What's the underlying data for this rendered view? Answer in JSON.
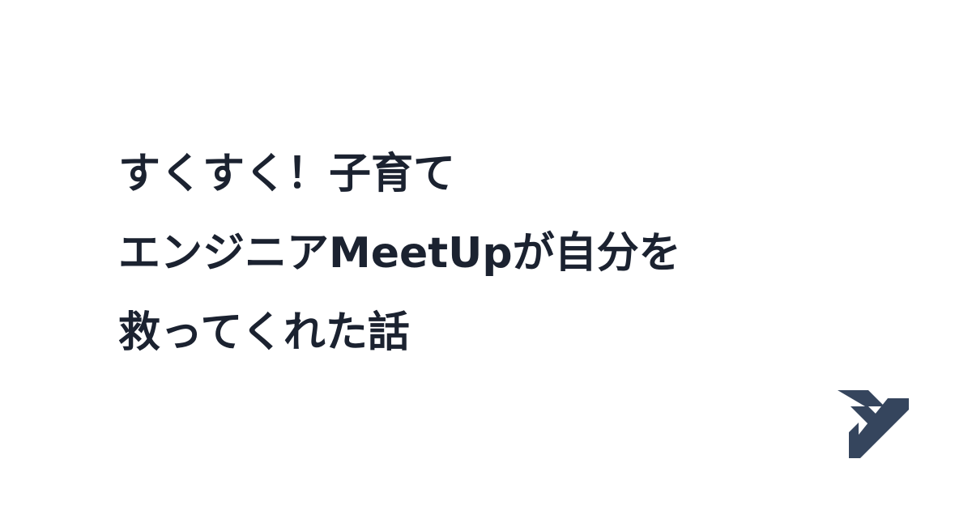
{
  "card": {
    "background": "#ffffff",
    "title_color": "#1b2230",
    "title_lines": [
      "すくすく！子育て",
      "エンジニアMeetUpが自分を",
      "救ってくれた話"
    ]
  },
  "logo": {
    "icon": "brand-y-logo-icon",
    "color": "#35455d"
  }
}
